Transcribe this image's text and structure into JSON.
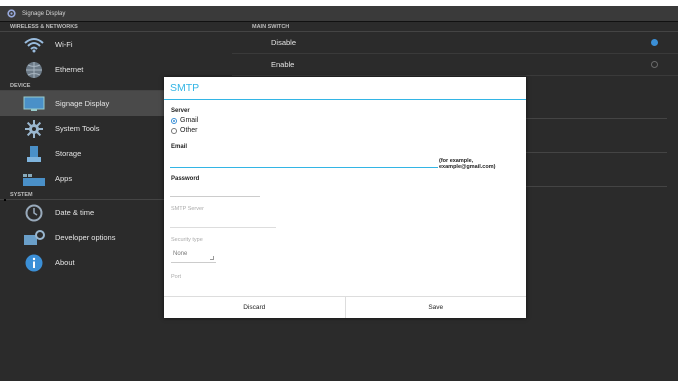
{
  "app": {
    "title": "Signage Display"
  },
  "left": {
    "sections": [
      {
        "title": "WIRELESS & NETWORKS",
        "items": [
          {
            "label": "Wi-Fi",
            "icon": "wifi-icon"
          },
          {
            "label": "Ethernet",
            "icon": "globe-icon"
          }
        ]
      },
      {
        "title": "DEVICE",
        "items": [
          {
            "label": "Signage Display",
            "icon": "display-icon",
            "active": true
          },
          {
            "label": "System Tools",
            "icon": "gear-icon"
          },
          {
            "label": "Storage",
            "icon": "storage-icon"
          },
          {
            "label": "Apps",
            "icon": "apps-icon"
          }
        ]
      },
      {
        "title": "SYSTEM",
        "items": [
          {
            "label": "Date & time",
            "icon": "clock-icon"
          },
          {
            "label": "Developer options",
            "icon": "developer-icon"
          },
          {
            "label": "About",
            "icon": "info-icon"
          }
        ]
      }
    ]
  },
  "right": {
    "section": "MAIN SWITCH",
    "options": [
      {
        "label": "Disable",
        "selected": true
      },
      {
        "label": "Enable",
        "selected": false
      }
    ]
  },
  "dialog": {
    "title": "SMTP",
    "server_label": "Server",
    "server_options": [
      {
        "label": "Gmail",
        "selected": true
      },
      {
        "label": "Other",
        "selected": false
      }
    ],
    "email_label": "Email",
    "email_value": "",
    "email_hint": "(for example, example@gmail.com)",
    "password_label": "Password",
    "password_value": "",
    "smtp_server_label": "SMTP Server",
    "security_type_label": "Security type",
    "security_type_value": "None",
    "port_label": "Port",
    "discard_label": "Discard",
    "save_label": "Save"
  },
  "colors": {
    "accent": "#33b5e5",
    "background": "#2b2b2b",
    "dialog_bg": "#ffffff"
  }
}
